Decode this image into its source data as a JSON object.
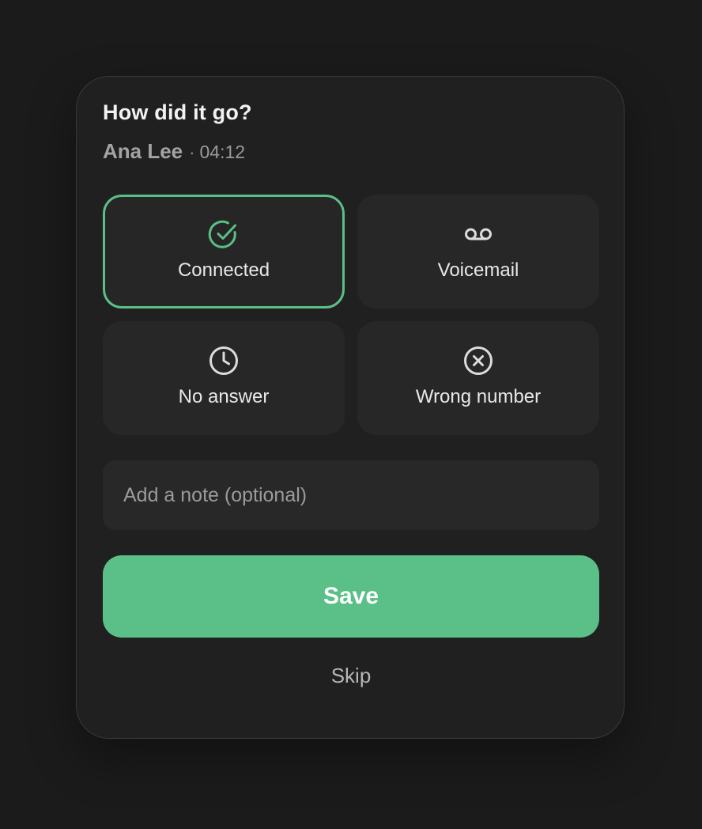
{
  "dialog": {
    "title": "How did it go?",
    "contact_name": "Ana Lee",
    "separator": "·",
    "duration": "04:12"
  },
  "options": [
    {
      "label": "Connected",
      "icon": "check-circle-icon",
      "selected": true
    },
    {
      "label": "Voicemail",
      "icon": "voicemail-icon",
      "selected": false
    },
    {
      "label": "No answer",
      "icon": "clock-icon",
      "selected": false
    },
    {
      "label": "Wrong number",
      "icon": "x-circle-icon",
      "selected": false
    }
  ],
  "note": {
    "placeholder": "Add a note (optional)",
    "value": ""
  },
  "actions": {
    "save_label": "Save",
    "skip_label": "Skip"
  },
  "colors": {
    "accent": "#5bbf88",
    "background": "#1b1b1b",
    "card": "#202020",
    "tile": "#272727",
    "text_primary": "#f2f2f2",
    "text_muted": "#a3a3a3"
  }
}
